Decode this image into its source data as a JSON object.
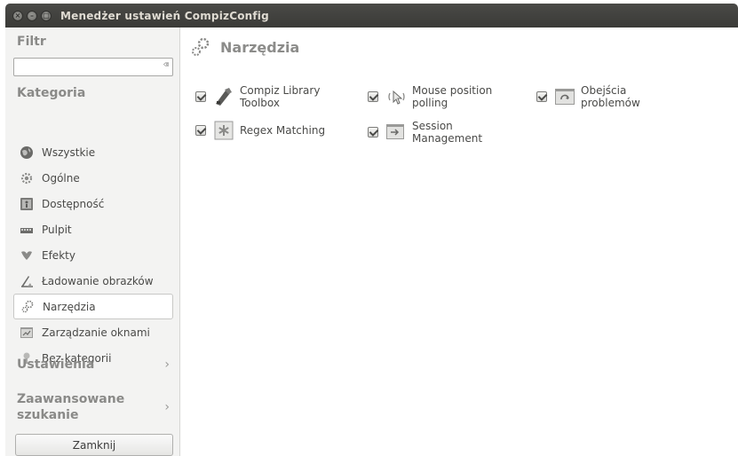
{
  "window": {
    "title": "Menedżer ustawień CompizConfig"
  },
  "sidebar": {
    "filter_label": "Filtr",
    "filter_value": "",
    "filter_clear": "⌫",
    "category_label": "Kategoria",
    "categories": [
      {
        "label": "Wszystkie",
        "icon": "globe-icon"
      },
      {
        "label": "Ogólne",
        "icon": "settings-gear-icon"
      },
      {
        "label": "Dostępność",
        "icon": "accessibility-icon"
      },
      {
        "label": "Pulpit",
        "icon": "desktop-icon"
      },
      {
        "label": "Efekty",
        "icon": "effects-icon"
      },
      {
        "label": "Ładowanie obrazków",
        "icon": "image-loading-icon"
      },
      {
        "label": "Narzędzia",
        "icon": "tools-icon",
        "selected": true
      },
      {
        "label": "Zarządzanie oknami",
        "icon": "window-management-icon"
      },
      {
        "label": "Bez kategorii",
        "icon": "uncategorized-icon"
      }
    ],
    "settings_label": "Ustawienia",
    "advanced_search_label_line1": "Zaawansowane",
    "advanced_search_label_line2": "szukanie",
    "chevron": "›",
    "close_button": "Zamknij"
  },
  "main": {
    "title": "Narzędzia",
    "plugins": [
      {
        "label": "Compiz Library\nToolbox",
        "enabled": true,
        "icon": "toolbox-icon"
      },
      {
        "label": "Mouse position\npolling",
        "enabled": true,
        "icon": "mouse-polling-icon"
      },
      {
        "label": "Obejścia\nproblemów",
        "enabled": true,
        "icon": "workarounds-icon"
      },
      {
        "label": "Regex Matching",
        "enabled": true,
        "icon": "regex-icon"
      },
      {
        "label": "Session\nManagement",
        "enabled": true,
        "icon": "session-icon"
      }
    ]
  }
}
